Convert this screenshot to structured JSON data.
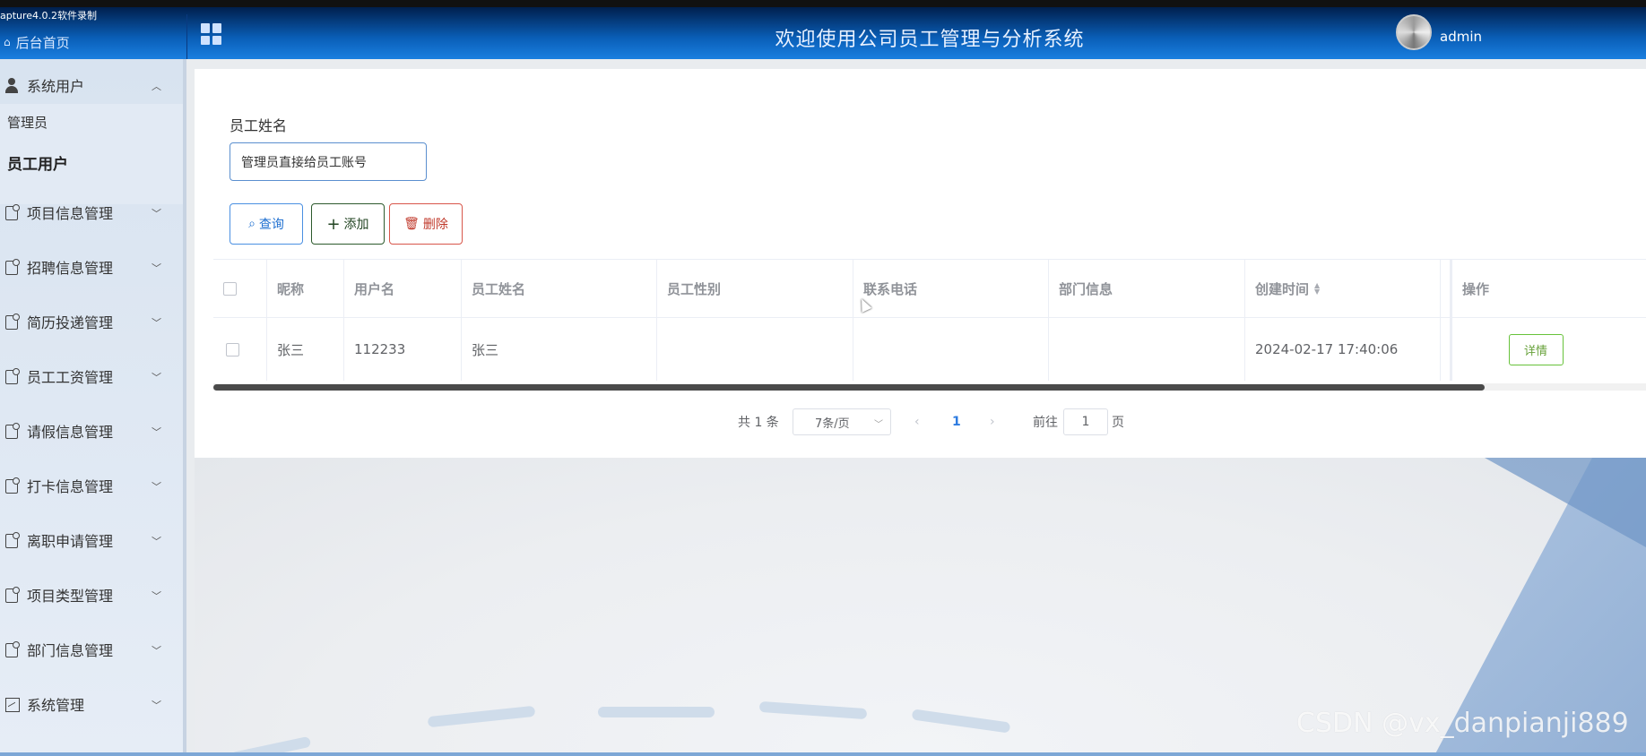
{
  "recorder_label": "apture4.0.2软件录制",
  "header": {
    "home_label": "后台首页",
    "title": "欢迎使用公司员工管理与分析系统",
    "username": "admin"
  },
  "sidebar": {
    "groups": [
      {
        "label": "系统用户",
        "expanded": true,
        "icon": "user-icon"
      },
      {
        "label": "项目信息管理",
        "icon": "doc-icon"
      },
      {
        "label": "招聘信息管理",
        "icon": "doc-icon"
      },
      {
        "label": "简历投递管理",
        "icon": "doc-icon"
      },
      {
        "label": "员工工资管理",
        "icon": "doc-icon"
      },
      {
        "label": "请假信息管理",
        "icon": "doc-icon"
      },
      {
        "label": "打卡信息管理",
        "icon": "doc-icon"
      },
      {
        "label": "离职申请管理",
        "icon": "doc-icon"
      },
      {
        "label": "项目类型管理",
        "icon": "doc-icon"
      },
      {
        "label": "部门信息管理",
        "icon": "doc-icon"
      },
      {
        "label": "系统管理",
        "icon": "image-icon"
      }
    ],
    "sub_items": [
      {
        "label": "管理员"
      },
      {
        "label": "员工用户",
        "active": true
      }
    ]
  },
  "search": {
    "field_label": "员工姓名",
    "value": "管理员直接给员工账号"
  },
  "buttons": {
    "query": "查询",
    "add": "添加",
    "delete": "删除"
  },
  "table": {
    "headers": [
      "昵称",
      "用户名",
      "员工姓名",
      "员工性别",
      "联系电话",
      "部门信息",
      "创建时间",
      "操作"
    ],
    "rows": [
      {
        "nickname": "张三",
        "username": "112233",
        "name": "张三",
        "gender": "",
        "phone": "",
        "department": "",
        "created": "2024-02-17 17:40:06",
        "action": "详情"
      }
    ]
  },
  "pagination": {
    "total_text": "共 1 条",
    "page_size": "7条/页",
    "current_page": "1",
    "goto_label": "前往",
    "goto_value": "1",
    "goto_suffix": "页"
  },
  "watermark": "CSDN @vx_danpianji889",
  "colors": {
    "header_top": "#001f4d",
    "header_bottom": "#1a7fe0",
    "query": "#1e6fd0",
    "add": "#224422",
    "delete": "#c0392b",
    "detail": "#67c23a"
  }
}
